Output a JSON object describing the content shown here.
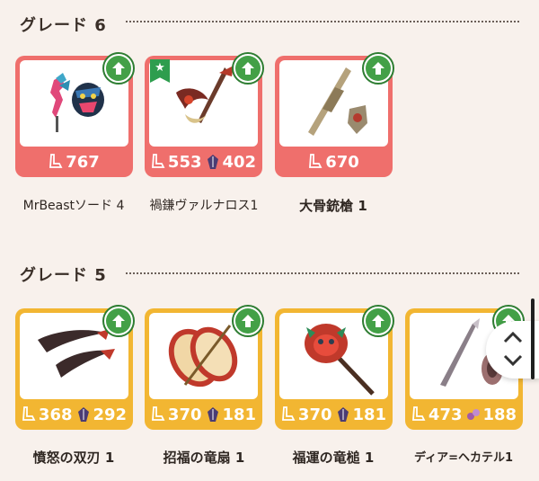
{
  "sections": [
    {
      "grade_label": "グレード 6",
      "cards": [
        {
          "name": "MrBeastソード 4",
          "frame": "red",
          "featured": false,
          "stat1": "767",
          "stat2": null
        },
        {
          "name": "禍鎌ヴァルナロス1",
          "frame": "red",
          "featured": true,
          "stat1": "553",
          "stat2": "402"
        },
        {
          "name": "大骨銃槍 1",
          "frame": "red",
          "featured": false,
          "stat1": "670",
          "stat2": null
        }
      ]
    },
    {
      "grade_label": "グレード 5",
      "cards": [
        {
          "name": "憤怒の双刃 1",
          "frame": "gold",
          "featured": false,
          "stat1": "368",
          "stat2": "292"
        },
        {
          "name": "招福の竜扇 1",
          "frame": "gold",
          "featured": false,
          "stat1": "370",
          "stat2": "181"
        },
        {
          "name": "福運の竜槌 1",
          "frame": "gold",
          "featured": false,
          "stat1": "370",
          "stat2": "181"
        },
        {
          "name": "ディア=ヘカテル1",
          "frame": "gold",
          "featured": false,
          "stat1": "473",
          "stat2": "188"
        }
      ]
    }
  ],
  "icons": {
    "upgrade": "upgrade-arrow-icon",
    "featured": "star-ribbon-icon",
    "attack": "weapon-attack-icon",
    "element": "element-crystal-icon",
    "scroll_up": "chevron-up-icon",
    "scroll_down": "chevron-down-icon"
  },
  "colors": {
    "grade6_frame": "#ef6f6c",
    "grade5_frame": "#f2b632",
    "upgrade_green": "#43a047",
    "background": "#f8f1ec"
  }
}
